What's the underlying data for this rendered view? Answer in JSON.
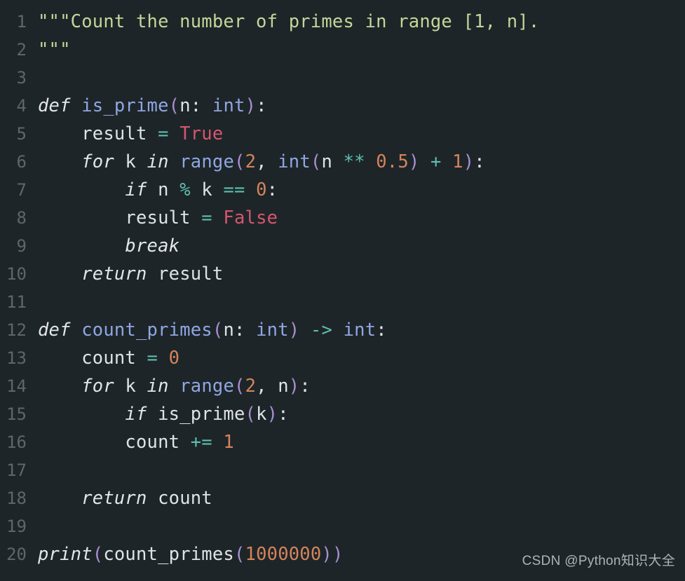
{
  "editor": {
    "language": "Python",
    "background_color": "#1e2528",
    "gutter_color": "#5b6769",
    "total_lines": 20,
    "colors": {
      "docstring": "#c3d79a",
      "keyword": "#e3e6e8",
      "function": "#8fa6e3",
      "builtin": "#8fa6e3",
      "plain": "#dfe3e6",
      "number": "#d4845c",
      "constant": "#d4566f",
      "operator": "#5fbfb0",
      "paren": "#a98fd4"
    }
  },
  "lines": [
    {
      "number": "1",
      "tokens": [
        {
          "text": "\"\"\"Count the number of primes in range [1, n].",
          "cls": "t-doc"
        }
      ]
    },
    {
      "number": "2",
      "tokens": [
        {
          "text": "\"\"\"",
          "cls": "t-doc"
        }
      ]
    },
    {
      "number": "3",
      "tokens": []
    },
    {
      "number": "4",
      "tokens": [
        {
          "text": "def",
          "cls": "t-kw"
        },
        {
          "text": " ",
          "cls": "t-plain"
        },
        {
          "text": "is_prime",
          "cls": "t-fn"
        },
        {
          "text": "(",
          "cls": "t-paren"
        },
        {
          "text": "n",
          "cls": "t-plain"
        },
        {
          "text": ":",
          "cls": "t-punct"
        },
        {
          "text": " ",
          "cls": "t-plain"
        },
        {
          "text": "int",
          "cls": "t-builtin"
        },
        {
          "text": ")",
          "cls": "t-paren"
        },
        {
          "text": ":",
          "cls": "t-punct"
        }
      ]
    },
    {
      "number": "5",
      "tokens": [
        {
          "text": "    result ",
          "cls": "t-plain"
        },
        {
          "text": "=",
          "cls": "t-op"
        },
        {
          "text": " ",
          "cls": "t-plain"
        },
        {
          "text": "True",
          "cls": "t-const"
        }
      ]
    },
    {
      "number": "6",
      "tokens": [
        {
          "text": "    ",
          "cls": "t-plain"
        },
        {
          "text": "for",
          "cls": "t-kw"
        },
        {
          "text": " k ",
          "cls": "t-plain"
        },
        {
          "text": "in",
          "cls": "t-kw"
        },
        {
          "text": " ",
          "cls": "t-plain"
        },
        {
          "text": "range",
          "cls": "t-builtin"
        },
        {
          "text": "(",
          "cls": "t-paren"
        },
        {
          "text": "2",
          "cls": "t-num"
        },
        {
          "text": ", ",
          "cls": "t-punct"
        },
        {
          "text": "int",
          "cls": "t-builtin"
        },
        {
          "text": "(",
          "cls": "t-paren"
        },
        {
          "text": "n ",
          "cls": "t-plain"
        },
        {
          "text": "**",
          "cls": "t-op"
        },
        {
          "text": " ",
          "cls": "t-plain"
        },
        {
          "text": "0.5",
          "cls": "t-num"
        },
        {
          "text": ")",
          "cls": "t-paren"
        },
        {
          "text": " ",
          "cls": "t-plain"
        },
        {
          "text": "+",
          "cls": "t-op"
        },
        {
          "text": " ",
          "cls": "t-plain"
        },
        {
          "text": "1",
          "cls": "t-num"
        },
        {
          "text": ")",
          "cls": "t-paren"
        },
        {
          "text": ":",
          "cls": "t-punct"
        }
      ]
    },
    {
      "number": "7",
      "tokens": [
        {
          "text": "        ",
          "cls": "t-plain"
        },
        {
          "text": "if",
          "cls": "t-kw"
        },
        {
          "text": " n ",
          "cls": "t-plain"
        },
        {
          "text": "%",
          "cls": "t-op"
        },
        {
          "text": " k ",
          "cls": "t-plain"
        },
        {
          "text": "==",
          "cls": "t-op"
        },
        {
          "text": " ",
          "cls": "t-plain"
        },
        {
          "text": "0",
          "cls": "t-num"
        },
        {
          "text": ":",
          "cls": "t-punct"
        }
      ]
    },
    {
      "number": "8",
      "tokens": [
        {
          "text": "        result ",
          "cls": "t-plain"
        },
        {
          "text": "=",
          "cls": "t-op"
        },
        {
          "text": " ",
          "cls": "t-plain"
        },
        {
          "text": "False",
          "cls": "t-const"
        }
      ]
    },
    {
      "number": "9",
      "tokens": [
        {
          "text": "        ",
          "cls": "t-plain"
        },
        {
          "text": "break",
          "cls": "t-kw"
        }
      ]
    },
    {
      "number": "10",
      "tokens": [
        {
          "text": "    ",
          "cls": "t-plain"
        },
        {
          "text": "return",
          "cls": "t-kw"
        },
        {
          "text": " result",
          "cls": "t-plain"
        }
      ]
    },
    {
      "number": "11",
      "tokens": []
    },
    {
      "number": "12",
      "tokens": [
        {
          "text": "def",
          "cls": "t-kw"
        },
        {
          "text": " ",
          "cls": "t-plain"
        },
        {
          "text": "count_primes",
          "cls": "t-fn"
        },
        {
          "text": "(",
          "cls": "t-paren"
        },
        {
          "text": "n",
          "cls": "t-plain"
        },
        {
          "text": ":",
          "cls": "t-punct"
        },
        {
          "text": " ",
          "cls": "t-plain"
        },
        {
          "text": "int",
          "cls": "t-builtin"
        },
        {
          "text": ")",
          "cls": "t-paren"
        },
        {
          "text": " ",
          "cls": "t-plain"
        },
        {
          "text": "->",
          "cls": "t-op"
        },
        {
          "text": " ",
          "cls": "t-plain"
        },
        {
          "text": "int",
          "cls": "t-builtin"
        },
        {
          "text": ":",
          "cls": "t-punct"
        }
      ]
    },
    {
      "number": "13",
      "tokens": [
        {
          "text": "    count ",
          "cls": "t-plain"
        },
        {
          "text": "=",
          "cls": "t-op"
        },
        {
          "text": " ",
          "cls": "t-plain"
        },
        {
          "text": "0",
          "cls": "t-num"
        }
      ]
    },
    {
      "number": "14",
      "tokens": [
        {
          "text": "    ",
          "cls": "t-plain"
        },
        {
          "text": "for",
          "cls": "t-kw"
        },
        {
          "text": " k ",
          "cls": "t-plain"
        },
        {
          "text": "in",
          "cls": "t-kw"
        },
        {
          "text": " ",
          "cls": "t-plain"
        },
        {
          "text": "range",
          "cls": "t-builtin"
        },
        {
          "text": "(",
          "cls": "t-paren"
        },
        {
          "text": "2",
          "cls": "t-num"
        },
        {
          "text": ", n",
          "cls": "t-punct"
        },
        {
          "text": ")",
          "cls": "t-paren"
        },
        {
          "text": ":",
          "cls": "t-punct"
        }
      ]
    },
    {
      "number": "15",
      "tokens": [
        {
          "text": "        ",
          "cls": "t-plain"
        },
        {
          "text": "if",
          "cls": "t-kw"
        },
        {
          "text": " is_prime",
          "cls": "t-plain"
        },
        {
          "text": "(",
          "cls": "t-paren"
        },
        {
          "text": "k",
          "cls": "t-plain"
        },
        {
          "text": ")",
          "cls": "t-paren"
        },
        {
          "text": ":",
          "cls": "t-punct"
        }
      ]
    },
    {
      "number": "16",
      "tokens": [
        {
          "text": "        count ",
          "cls": "t-plain"
        },
        {
          "text": "+=",
          "cls": "t-op"
        },
        {
          "text": " ",
          "cls": "t-plain"
        },
        {
          "text": "1",
          "cls": "t-num"
        }
      ]
    },
    {
      "number": "17",
      "tokens": []
    },
    {
      "number": "18",
      "tokens": [
        {
          "text": "    ",
          "cls": "t-plain"
        },
        {
          "text": "return",
          "cls": "t-kw"
        },
        {
          "text": " count",
          "cls": "t-plain"
        }
      ]
    },
    {
      "number": "19",
      "tokens": []
    },
    {
      "number": "20",
      "tokens": [
        {
          "text": "print",
          "cls": "t-kw"
        },
        {
          "text": "(",
          "cls": "t-paren"
        },
        {
          "text": "count_primes",
          "cls": "t-plain"
        },
        {
          "text": "(",
          "cls": "t-paren"
        },
        {
          "text": "1000000",
          "cls": "t-num"
        },
        {
          "text": "))",
          "cls": "t-paren"
        }
      ]
    }
  ],
  "watermark": {
    "text": "CSDN @Python知识大全"
  }
}
